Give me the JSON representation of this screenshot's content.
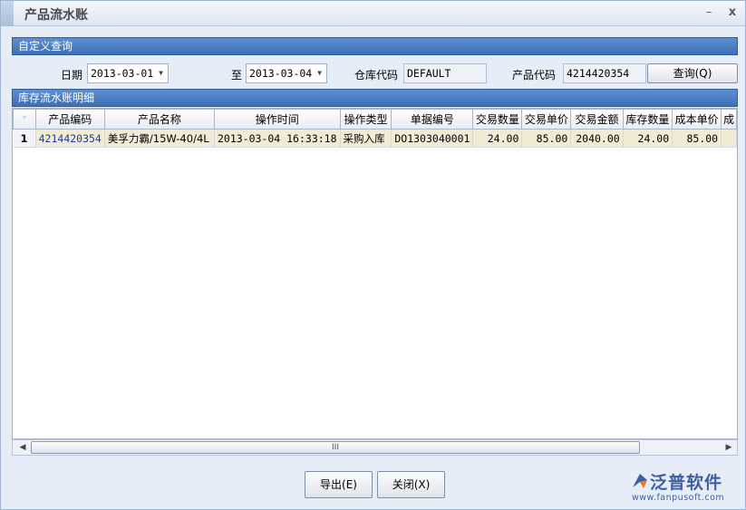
{
  "window": {
    "title": "产品流水账",
    "minimize_glyph": "–",
    "close_glyph": "x"
  },
  "query_section": {
    "header": "自定义查询",
    "date_label": "日期",
    "date_from": "2013-03-01",
    "to_label": "至",
    "date_to": "2013-03-04",
    "warehouse_label": "仓库代码",
    "warehouse_value": "DEFAULT",
    "product_label": "产品代码",
    "product_value": "4214420354",
    "query_button": "查询(Q)"
  },
  "detail_section": {
    "header": "库存流水账明细",
    "corner_glyph": "*",
    "columns": [
      "产品编码",
      "产品名称",
      "操作时间",
      "操作类型",
      "单据编号",
      "交易数量",
      "交易单价",
      "交易金额",
      "库存数量",
      "成本单价",
      "成"
    ],
    "rows": [
      {
        "row_number": "1",
        "cells": [
          "4214420354",
          "美孚力霸/15W-40/4L",
          "2013-03-04 16:33:18",
          "采购入库",
          "DO1303040001",
          "24.00",
          "85.00",
          "2040.00",
          "24.00",
          "85.00",
          ""
        ]
      }
    ]
  },
  "scrollbar": {
    "left_glyph": "◀",
    "right_glyph": "▶",
    "thumb_grip": "III"
  },
  "footer": {
    "export_button": "导出(E)",
    "close_button": "关闭(X)"
  },
  "logo": {
    "name": "泛普软件",
    "url": "www.fanpusoft.com",
    "brand_color": "#3d5fa5"
  },
  "colors": {
    "panel_header": "#4a7cc2",
    "row_highlight": "#f1ead5",
    "link_text": "#1e3f9a"
  }
}
